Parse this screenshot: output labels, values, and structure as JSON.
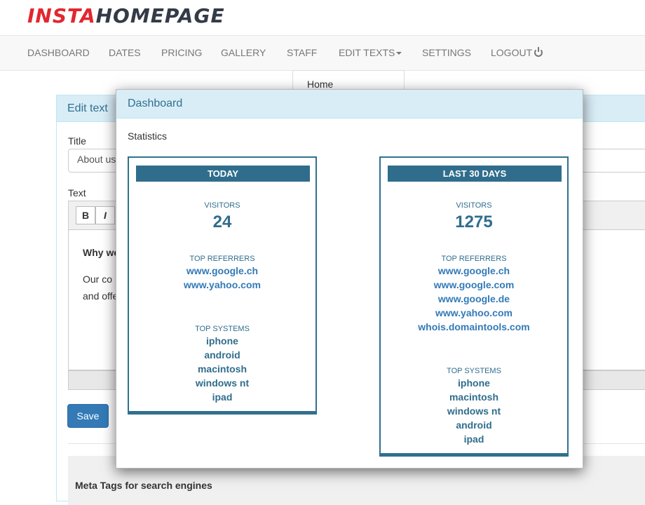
{
  "logo": {
    "part1": "insta",
    "part2": "homepage"
  },
  "nav": {
    "items": [
      {
        "label": "DASHBOARD"
      },
      {
        "label": "DATES"
      },
      {
        "label": "PRICING"
      },
      {
        "label": "GALLERY"
      },
      {
        "label": "STAFF"
      },
      {
        "label": "EDIT TEXTS"
      },
      {
        "label": "SETTINGS"
      },
      {
        "label": "LOGOUT"
      }
    ],
    "dropdown_item": "Home"
  },
  "edit_panel": {
    "title": "Edit text",
    "title_label": "Title",
    "title_value": "About us",
    "text_label": "Text",
    "toolbar": {
      "bold": "B",
      "italic": "I"
    },
    "content_heading": "Why we",
    "content_line1": "Our co",
    "content_line2": "and offe",
    "save_label": "Save",
    "meta_title": "Meta Tags for search engines"
  },
  "modal": {
    "title": "Dashboard",
    "subtitle": "Statistics",
    "today": {
      "header": "TODAY",
      "visitors_label": "VISITORS",
      "visitors": "24",
      "referrers_label": "TOP REFERRERS",
      "referrers": [
        "www.google.ch",
        "www.yahoo.com"
      ],
      "systems_label": "TOP SYSTEMS",
      "systems": [
        "iphone",
        "android",
        "macintosh",
        "windows nt",
        "ipad"
      ]
    },
    "last30": {
      "header": "LAST 30 DAYS",
      "visitors_label": "VISITORS",
      "visitors": "1275",
      "referrers_label": "TOP REFERRERS",
      "referrers": [
        "www.google.ch",
        "www.google.com",
        "www.google.de",
        "www.yahoo.com",
        "whois.domaintools.com"
      ],
      "systems_label": "TOP SYSTEMS",
      "systems": [
        "iphone",
        "macintosh",
        "windows nt",
        "android",
        "ipad"
      ]
    }
  },
  "colors": {
    "accent": "#306d8c",
    "link": "#337ab7",
    "logo_red": "#e3262e",
    "logo_dark": "#333b47"
  }
}
